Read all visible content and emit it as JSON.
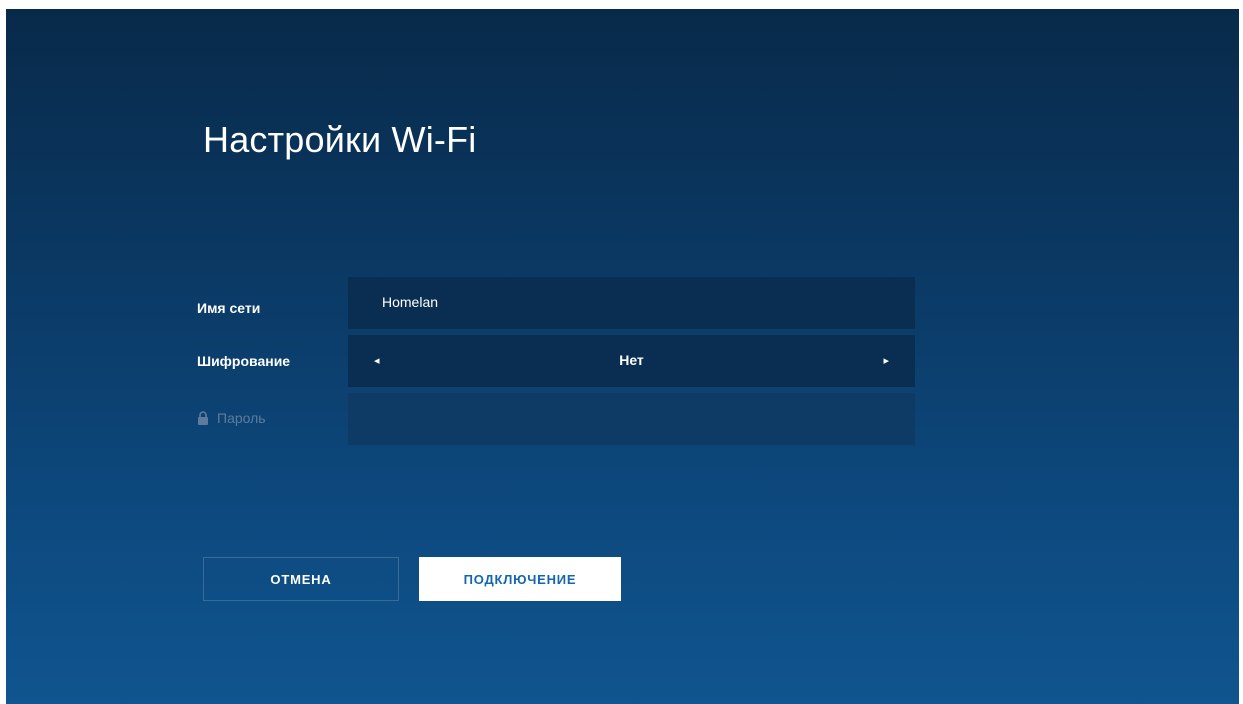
{
  "page": {
    "title": "Настройки Wi-Fi"
  },
  "form": {
    "network_name": {
      "label": "Имя сети",
      "value": "Homelan"
    },
    "encryption": {
      "label": "Шифрование",
      "value": "Нет",
      "prev_icon": "triangle-left",
      "next_icon": "triangle-right"
    },
    "password": {
      "label": "Пароль",
      "value": "",
      "icon": "lock-icon",
      "enabled": false
    }
  },
  "buttons": {
    "cancel_label": "ОТМЕНА",
    "connect_label": "ПОДКЛЮЧЕНИЕ"
  },
  "colors": {
    "background_top": "#082a4a",
    "background_bottom": "#10558f",
    "field_bg": "#0a2e52",
    "accent_text": "#1366b0"
  }
}
